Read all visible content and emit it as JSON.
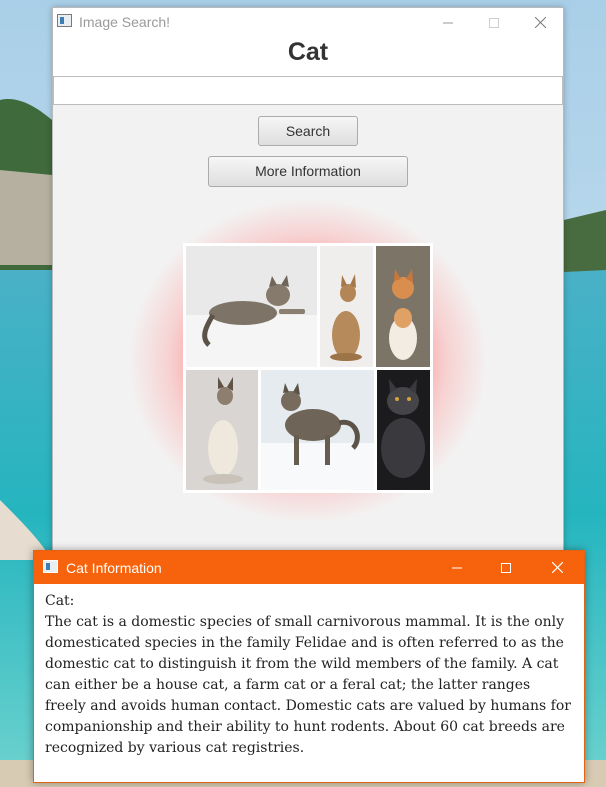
{
  "main_window": {
    "title": "Image Search!",
    "heading": "Cat",
    "search": {
      "value": "",
      "placeholder": ""
    },
    "search_button": "Search",
    "more_info_button": "More Information",
    "glow_color": "#ff3c3c"
  },
  "info_window": {
    "title": "Cat Information",
    "accent": "#f7630c",
    "label": "Cat:",
    "description": "The cat is a domestic species of small carnivorous mammal. It is the only domesticated species in the family Felidae and is often referred to as the domestic cat to distinguish it from the wild members of the family. A cat can either be a house cat, a farm cat or a feral cat; the latter ranges freely and avoids human contact. Domestic cats are valued by humans for companionship and their ability to hunt rodents. About 60 cat breeds are recognized by various cat registries."
  }
}
